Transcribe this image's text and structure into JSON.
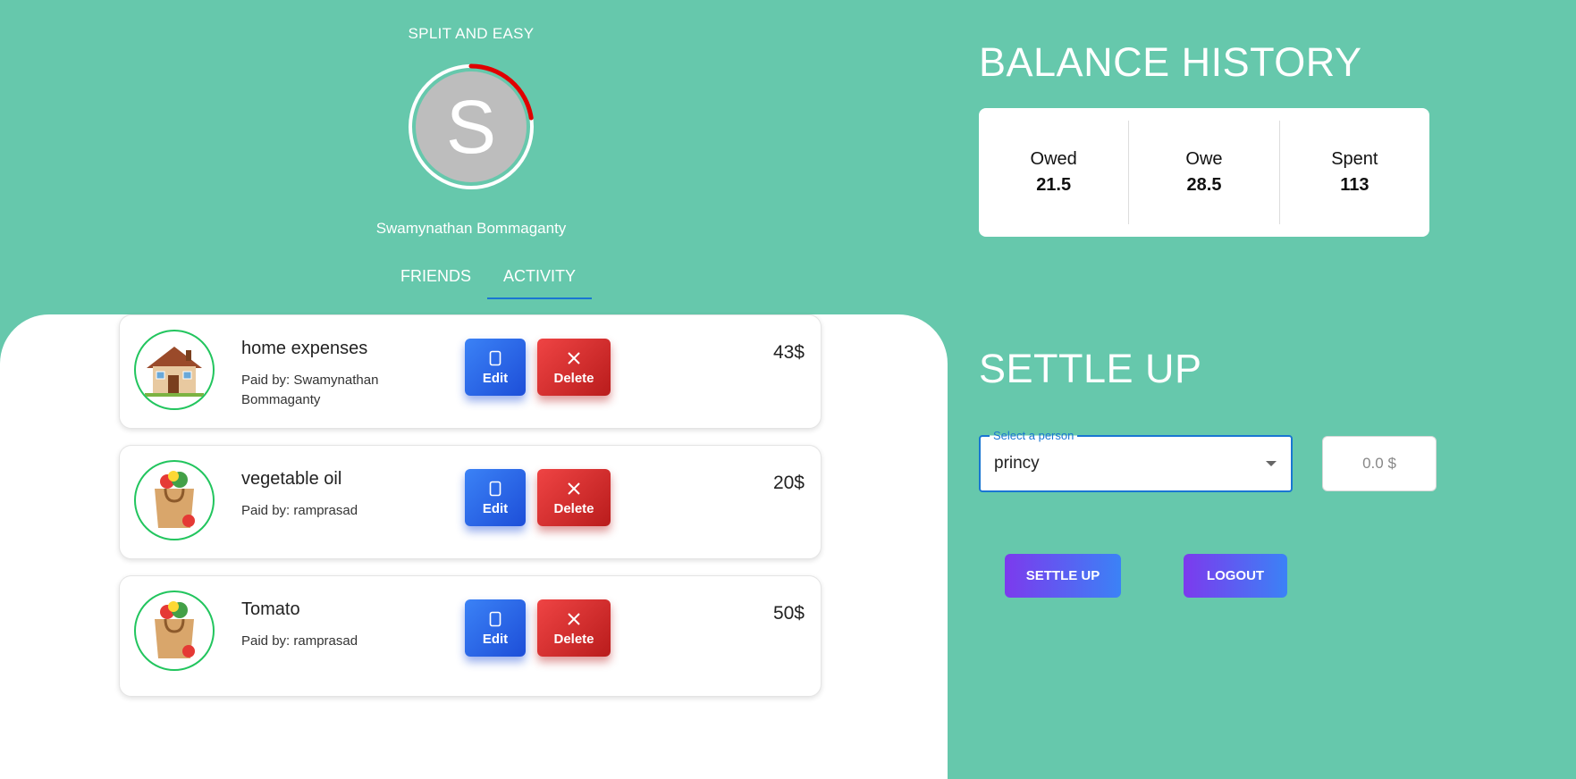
{
  "app": {
    "title": "SPLIT AND EASY"
  },
  "user": {
    "initial": "S",
    "name": "Swamynathan Bommaganty"
  },
  "tabs": [
    {
      "label": "FRIENDS",
      "active": false
    },
    {
      "label": "ACTIVITY",
      "active": true
    }
  ],
  "activity": [
    {
      "title": "home expenses",
      "paid_by": "Paid by: Swamynathan Bommaganty",
      "amount": "43$",
      "icon": "house-icon",
      "edit_label": "Edit",
      "delete_label": "Delete"
    },
    {
      "title": "vegetable oil",
      "paid_by": "Paid by: ramprasad",
      "amount": "20$",
      "icon": "grocery-bag-icon",
      "edit_label": "Edit",
      "delete_label": "Delete"
    },
    {
      "title": "Tomato",
      "paid_by": "Paid by: ramprasad",
      "amount": "50$",
      "icon": "grocery-bag-icon",
      "edit_label": "Edit",
      "delete_label": "Delete"
    }
  ],
  "balance": {
    "title": "BALANCE HISTORY",
    "owed_label": "Owed",
    "owed_value": "21.5",
    "owe_label": "Owe",
    "owe_value": "28.5",
    "spent_label": "Spent",
    "spent_value": "113"
  },
  "settle": {
    "title": "SETTLE UP",
    "select_label": "Select a person",
    "select_value": "princy",
    "amount_placeholder": "0.0 $",
    "settle_button": "SETTLE UP",
    "logout_button": "LOGOUT"
  },
  "colors": {
    "background": "#66c8ac",
    "accent": "#1976d2",
    "edit": "#2563eb",
    "delete": "#dc2626",
    "progress": "#e00000",
    "icon_ring": "#22c55e"
  }
}
